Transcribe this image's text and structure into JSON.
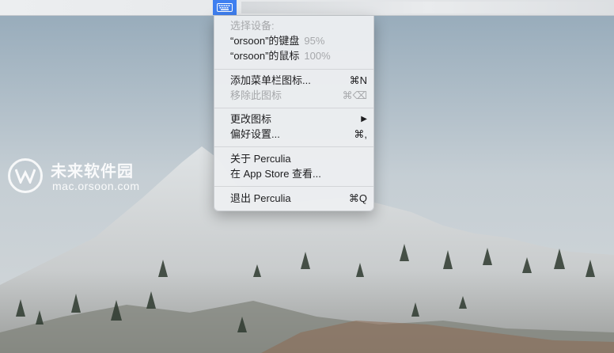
{
  "menu": {
    "section_header": "选择设备:",
    "devices": [
      {
        "label": "“orsoon”的键盘",
        "battery": "95%"
      },
      {
        "label": "“orsoon”的鼠标",
        "battery": "100%"
      }
    ],
    "add_menubar_icon": {
      "label": "添加菜单栏图标...",
      "shortcut": "⌘N"
    },
    "remove_icon": {
      "label": "移除此图标",
      "shortcut": "⌘⌫"
    },
    "change_icon": {
      "label": "更改图标",
      "submenu_arrow": "▶"
    },
    "preferences": {
      "label": "偏好设置...",
      "shortcut": "⌘,"
    },
    "about": {
      "label": "关于 Perculia"
    },
    "app_store": {
      "label": "在 App Store 查看..."
    },
    "quit": {
      "label": "退出 Perculia",
      "shortcut": "⌘Q"
    }
  },
  "watermark": {
    "title": "未来软件园",
    "subtitle": "mac.orsoon.com"
  },
  "colors": {
    "status_icon_bg": "#3f7ff0",
    "menu_bg": "#eceef0",
    "disabled_text": "#a6a8ab"
  }
}
